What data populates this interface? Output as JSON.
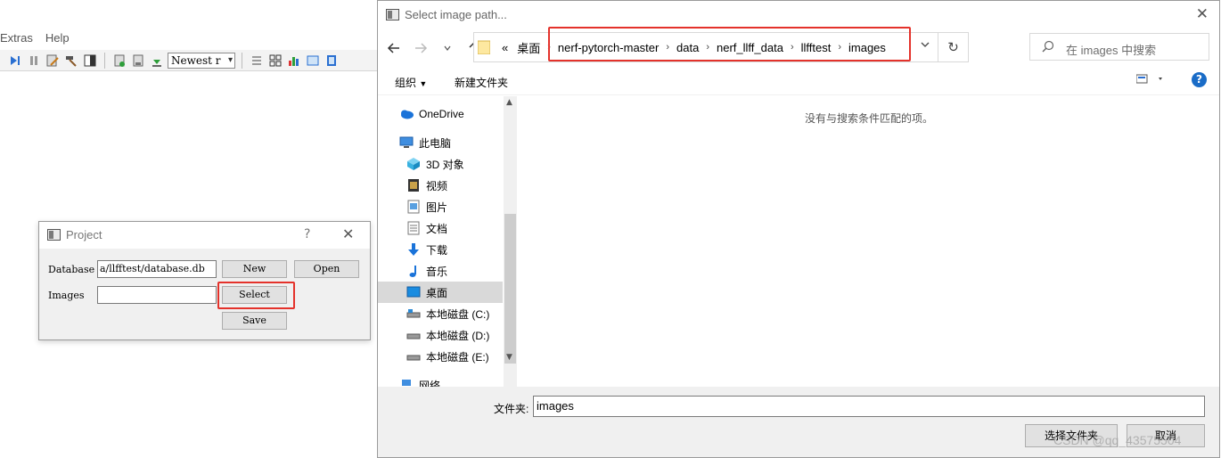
{
  "app": {
    "menus": [
      "Extras",
      "Help"
    ],
    "toolbar_combo": "Newest r"
  },
  "project_dialog": {
    "title": "Project",
    "help_glyph": "?",
    "close_glyph": "✕",
    "database_label": "Database",
    "database_value": "a/llfftest/database.db",
    "new_label": "New",
    "open_label": "Open",
    "images_label": "Images",
    "images_value": "",
    "select_label": "Select",
    "save_label": "Save"
  },
  "file_dialog": {
    "title": "Select image path...",
    "close_glyph": "✕",
    "breadcrumb_prefix": "«",
    "breadcrumb_root": "桌面",
    "breadcrumbs": [
      "nerf-pytorch-master",
      "data",
      "nerf_llff_data",
      "llfftest",
      "images"
    ],
    "search_placeholder": "在 images 中搜索",
    "organize_label": "组织",
    "new_folder_label": "新建文件夹",
    "help_glyph": "?",
    "nav_items": [
      {
        "label": "OneDrive",
        "icon": "cloud-icon"
      },
      {
        "label": "此电脑",
        "icon": "computer-icon"
      },
      {
        "label": "3D 对象",
        "icon": "cube-icon"
      },
      {
        "label": "视频",
        "icon": "video-icon"
      },
      {
        "label": "图片",
        "icon": "picture-icon"
      },
      {
        "label": "文档",
        "icon": "document-icon"
      },
      {
        "label": "下载",
        "icon": "download-icon"
      },
      {
        "label": "音乐",
        "icon": "music-icon"
      },
      {
        "label": "桌面",
        "icon": "desktop-icon"
      },
      {
        "label": "本地磁盘 (C:)",
        "icon": "drive-icon"
      },
      {
        "label": "本地磁盘 (D:)",
        "icon": "drive-icon"
      },
      {
        "label": "本地磁盘 (E:)",
        "icon": "drive-icon"
      },
      {
        "label": "网络",
        "icon": "network-icon"
      }
    ],
    "selected_nav": "桌面",
    "empty_message": "没有与搜索条件匹配的项。",
    "folder_label": "文件夹:",
    "folder_value": "images",
    "select_folder_label": "选择文件夹",
    "cancel_label": "取消"
  },
  "watermark": "CSDN @qq_43575504",
  "colors": {
    "highlight": "#e4322b",
    "accent": "#1a6cc7"
  }
}
